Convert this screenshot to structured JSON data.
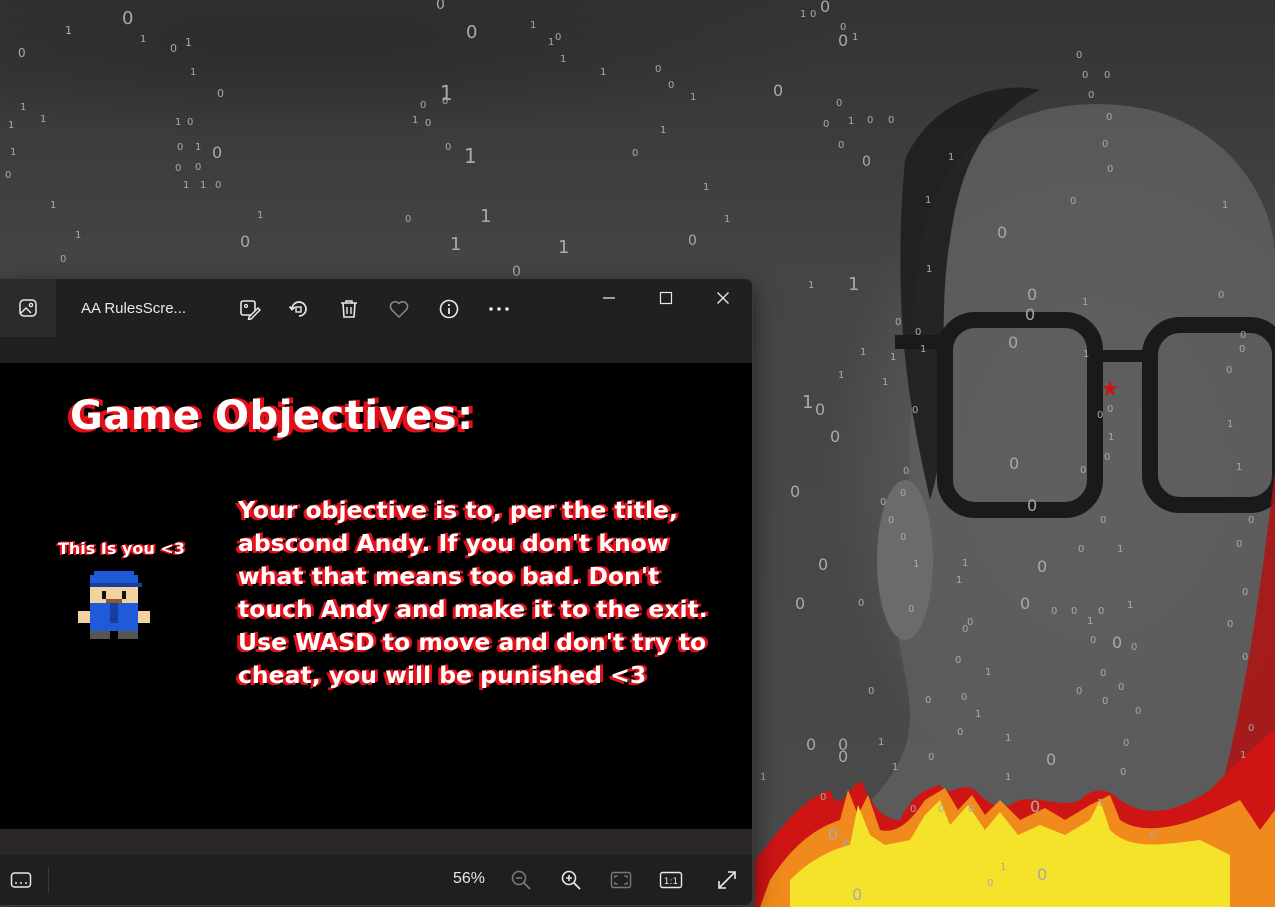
{
  "window": {
    "title": "AA RulesScre...",
    "zoom_label": "56%"
  },
  "toolbar": {
    "icons": [
      "photos-app-icon",
      "edit-image-icon",
      "rotate-icon",
      "delete-icon",
      "favorite-heart-icon",
      "info-icon",
      "more-options-icon"
    ]
  },
  "window_controls": [
    "minimize-icon",
    "maximize-icon",
    "close-icon"
  ],
  "bottombar": {
    "icons": [
      "filmstrip-icon",
      "zoom-out-icon",
      "zoom-in-icon",
      "fit-to-window-icon",
      "actual-size-icon",
      "fullscreen-icon"
    ],
    "actual_size_label": "1:1"
  },
  "image": {
    "title": "Game Objectives:",
    "caption": "This Is you <3",
    "body": "Your objective is to, per the title, abscond Andy. If you don't know what that means too bad. Don't touch Andy and make it to the exit. Use WASD to move and don't try to cheat, you will be punished <3"
  },
  "colors": {
    "accent_red": "#e3101a",
    "image_background": "#000000",
    "window_background": "#202020",
    "player_blue": "#1f5ad8",
    "flame_yellow": "#f5e22b",
    "flame_orange": "#f08a1c",
    "flame_red": "#cf1414"
  }
}
